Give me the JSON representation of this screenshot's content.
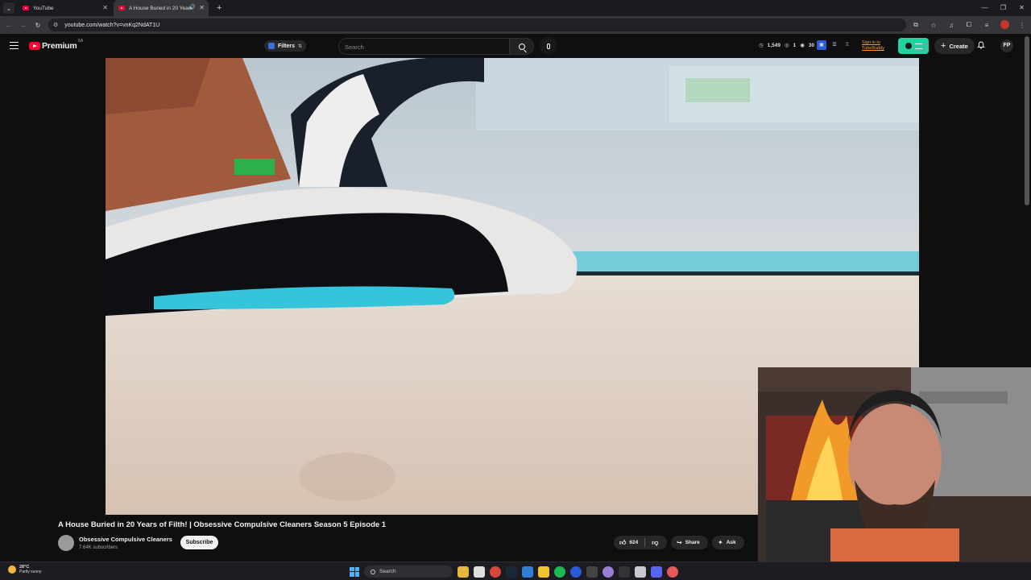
{
  "browser": {
    "tabs": [
      {
        "label": "YouTube",
        "active": false
      },
      {
        "label": "A House Buried in 20 Years",
        "active": true
      }
    ],
    "url": "youtube.com/watch?v=vnKq2NdAT1U"
  },
  "header": {
    "logo_text": "Premium",
    "logo_region": "SA",
    "filters_label": "Filters",
    "search_placeholder": "Search",
    "stats": {
      "views": "1,549",
      "stat2": "1",
      "stat3": "30"
    },
    "signin_line1": "Sign in to",
    "signin_line2": "TubeBuddy",
    "create_label": "Create",
    "avatar_initials": "FP"
  },
  "video": {
    "title": "A House Buried in 20 Years of Filth! | Obsessive Compulsive Cleaners Season 5 Episode 1",
    "channel": "Obsessive Compulsive Cleaners",
    "subscribers": "7.64K subscribers",
    "subscribe_label": "Subscribe",
    "likes": "624",
    "share_label": "Share",
    "ask_label": "Ask"
  },
  "taskbar": {
    "temperature": "28°C",
    "weather_desc": "Partly sunny",
    "search_label": "Search"
  },
  "colors": {
    "accent_red": "#ff0033",
    "tubebuddy": "#22d3a0",
    "signin": "#f0a030"
  }
}
